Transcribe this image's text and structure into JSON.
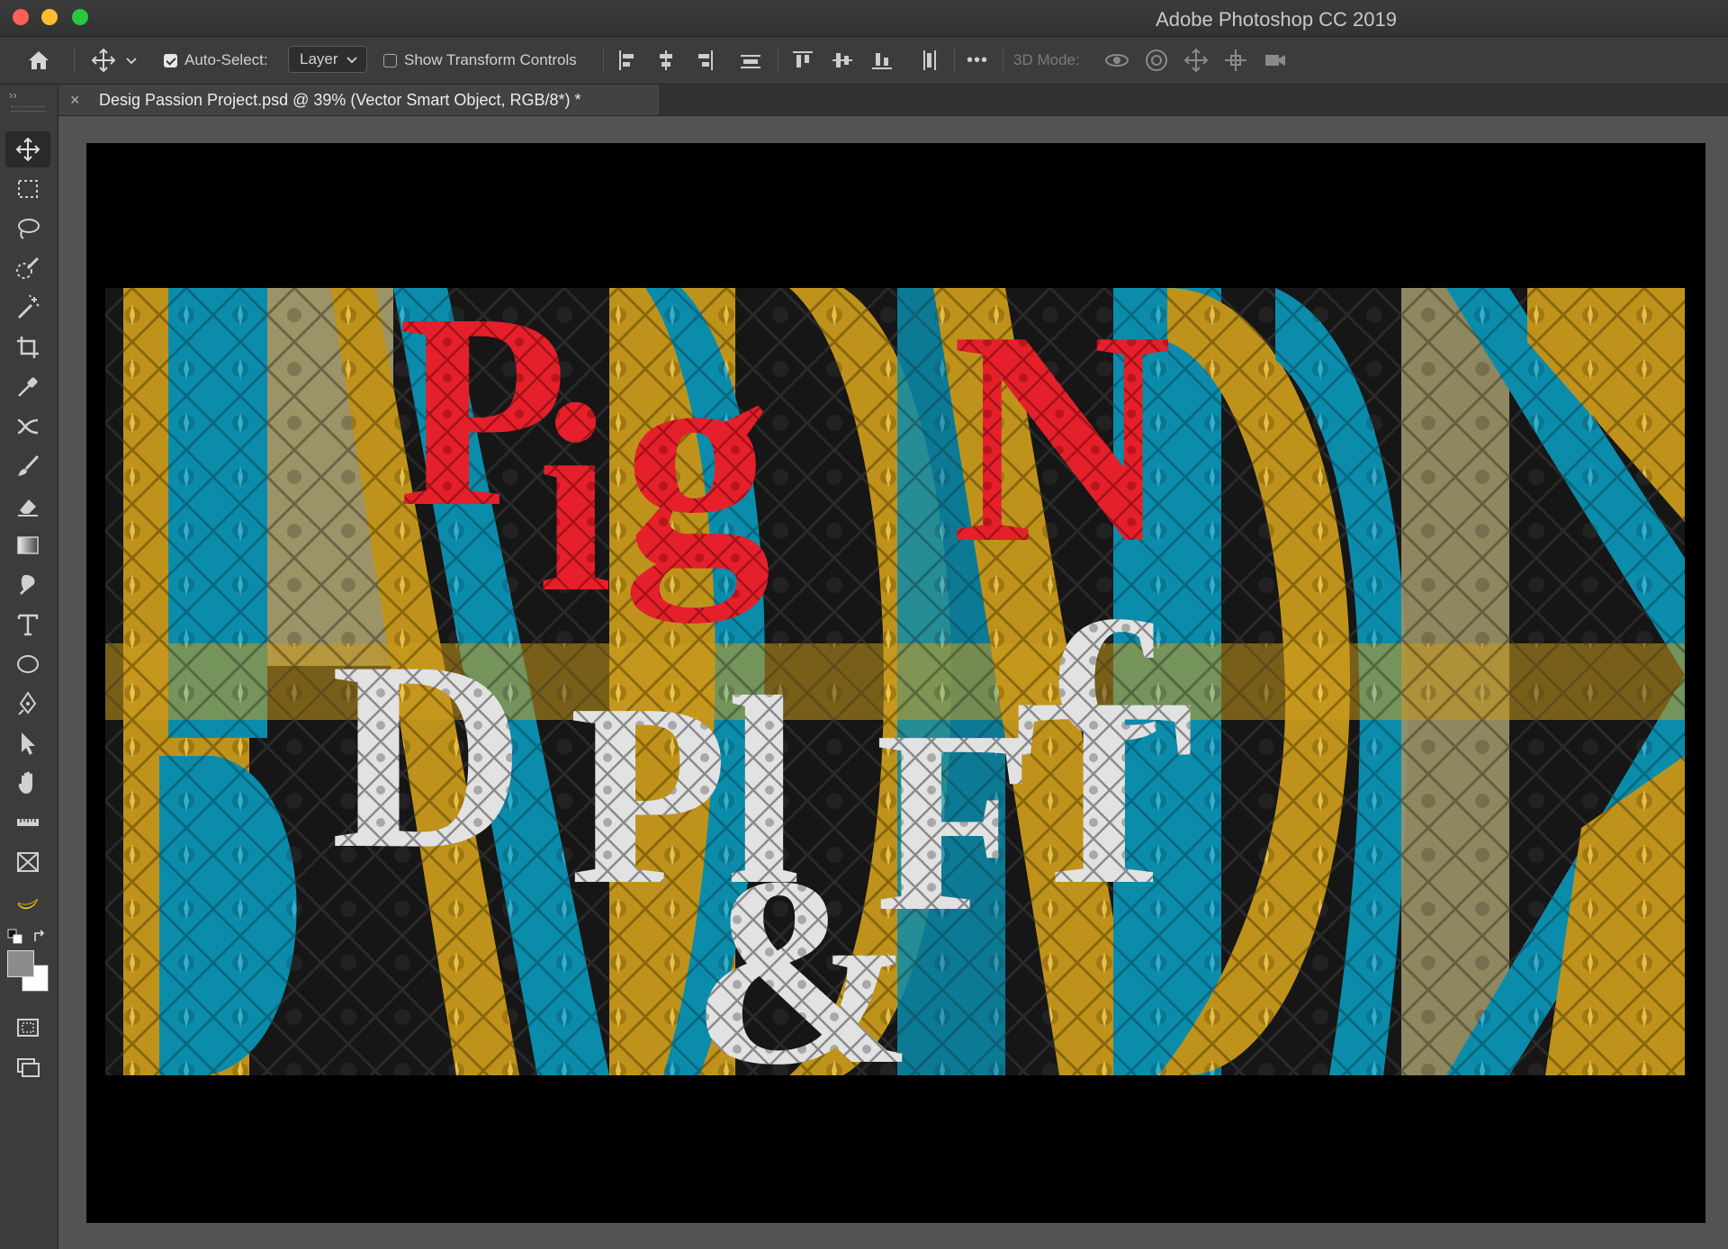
{
  "window": {
    "app_title": "Adobe Photoshop CC 2019",
    "traffic_colors": [
      "#fe5f57",
      "#febc2e",
      "#28c840"
    ]
  },
  "options_bar": {
    "auto_select_label": "Auto-Select:",
    "auto_select_checked": true,
    "layer_select_value": "Layer",
    "show_transform_label": "Show Transform Controls",
    "show_transform_checked": false,
    "more_label": "•••",
    "mode_3d_label": "3D Mode:"
  },
  "document": {
    "tab_title": "Desig Passion Project.psd @ 39% (Vector Smart Object, RGB/8*) *",
    "zoom": "39%",
    "color_mode": "RGB/8"
  },
  "colors": {
    "teal": "#0b93b4",
    "gold": "#c99a1c",
    "red": "#e5202a",
    "silver": "#d9d9d9",
    "dark": "#141414"
  },
  "tools": [
    "move-tool",
    "marquee-tool",
    "lasso-tool",
    "quick-selection-tool",
    "magic-wand-tool",
    "crop-tool",
    "eyedropper-tool",
    "healing-tool",
    "brush-tool",
    "eraser-tool",
    "gradient-tool",
    "smudge-tool",
    "type-tool",
    "ellipse-tool",
    "pen-tool",
    "path-selection-tool",
    "hand-tool",
    "ruler-tool",
    "frame-tool",
    "banana-tool"
  ]
}
